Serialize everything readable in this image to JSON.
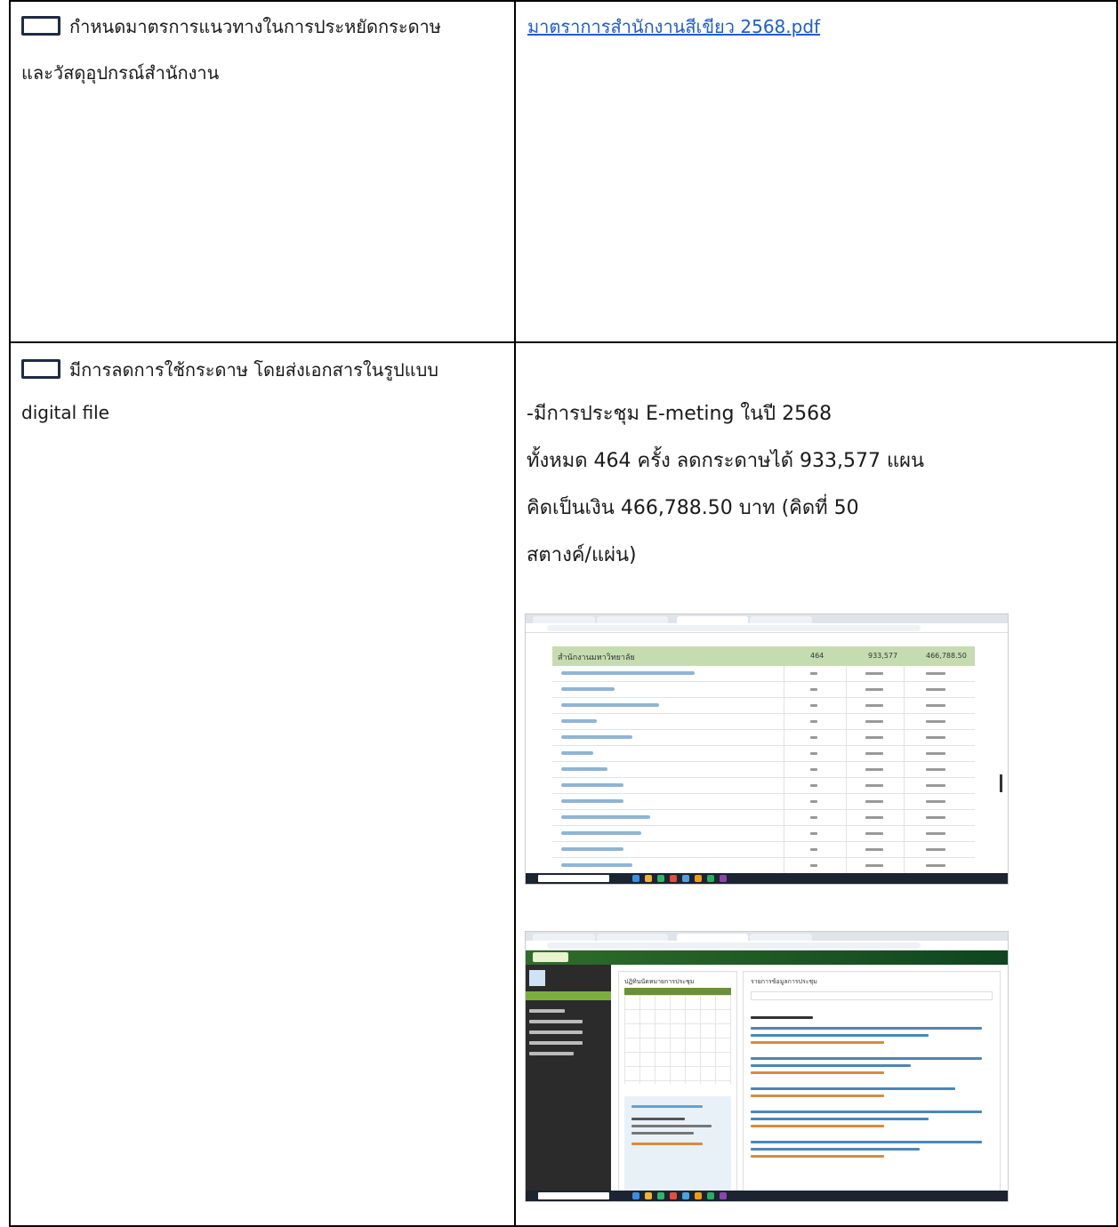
{
  "row1": {
    "item_line1": "กำหนดมาตรการแนวทางในการประหยัดกระดาษ",
    "item_line2": "และวัสดุอุปกรณ์สำนักงาน",
    "evidence_link": "มาตราการสำนักงานสีเขียว 2568.pdf"
  },
  "row2": {
    "item_line1": "มีการลดการใช้กระดาษ โดยส่งเอกสารในรูปแบบ",
    "item_line2": "digital file",
    "evidence": {
      "line1": "-มีการประชุม E-meting ในปี 2568",
      "line2": "ทั้งหมด 464 ครั้ง ลดกระดาษได้ 933,577 แผน",
      "line3": "คิดเป็นเงิน 466,788.50 บาท (คิดที่ 50",
      "line4": "สตางค์/แผ่น)"
    }
  },
  "screenshot1": {
    "header_title": "สำนักงานมหาวิทยาลัย",
    "header_count": "464",
    "header_sheets": "933,577",
    "header_amount": "466,788.50"
  },
  "screenshot2": {
    "left_title": "ปฏิทินนัดหมายการประชุม",
    "right_title": "รายการข้อมูลการประชุม"
  },
  "colors": {
    "link": "#1f5dcf",
    "checkbox_border": "#1e2a44",
    "report_header": "#c5dcb0",
    "app_header": "#2f6d2a"
  }
}
